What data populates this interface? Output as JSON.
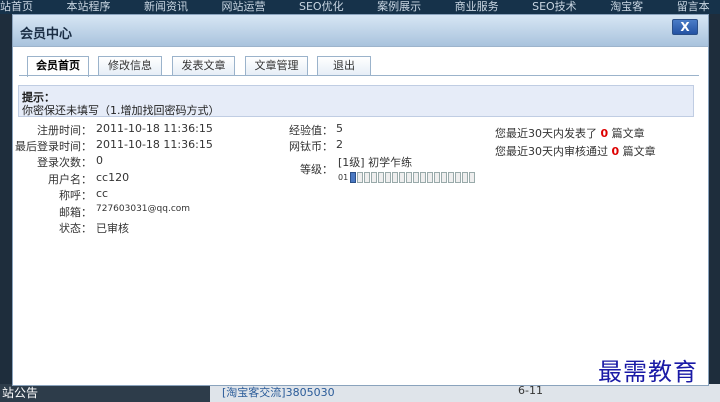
{
  "background": {
    "nav": [
      "站首页",
      "本站程序",
      "新闻资讯",
      "网站运营",
      "SEO优化",
      "案例展示",
      "商业服务",
      "SEO技术",
      "淘宝客",
      "留言本"
    ],
    "bottom_left_text": "站公告",
    "bottom_link": "[淘宝客交流]3805030",
    "bottom_count": "6-11"
  },
  "dialog": {
    "title": "会员中心",
    "close_label": "X"
  },
  "tabs": [
    {
      "label": "会员首页",
      "active": true
    },
    {
      "label": "修改信息"
    },
    {
      "label": "发表文章"
    },
    {
      "label": "文章管理"
    },
    {
      "label": "退出"
    }
  ],
  "notice": {
    "title": "提示：",
    "text": "你密保还未填写（1.增加找回密码方式）"
  },
  "profile": {
    "reg_time_label": "注册时间：",
    "reg_time": "2011-10-18 11:36:15",
    "last_login_label": "最后登录时间：",
    "last_login": "2011-10-18 11:36:15",
    "login_count_label": "登录次数：",
    "login_count": "0",
    "username_label": "用户名：",
    "username": "cc120",
    "nickname_label": "称呼：",
    "nickname": "cc",
    "email_label": "邮箱：",
    "email": "727603031@qq.com",
    "status_label": "状态：",
    "status": "已审核"
  },
  "stats": {
    "exp_label": "经验值：",
    "exp": "5",
    "coin_label": "网钛币：",
    "coin": "2",
    "level_label": "等级：",
    "level": "[1级] 初学乍练",
    "level_bar_label": "01",
    "level_value": 1,
    "level_max": 18
  },
  "activity": {
    "post_prefix": "您最近30天内发表了",
    "post_count": "0",
    "post_suffix": "篇文章",
    "approved_prefix": "您最近30天内审核通过",
    "approved_count": "0",
    "approved_suffix": "篇文章"
  },
  "watermark": "最需教育"
}
